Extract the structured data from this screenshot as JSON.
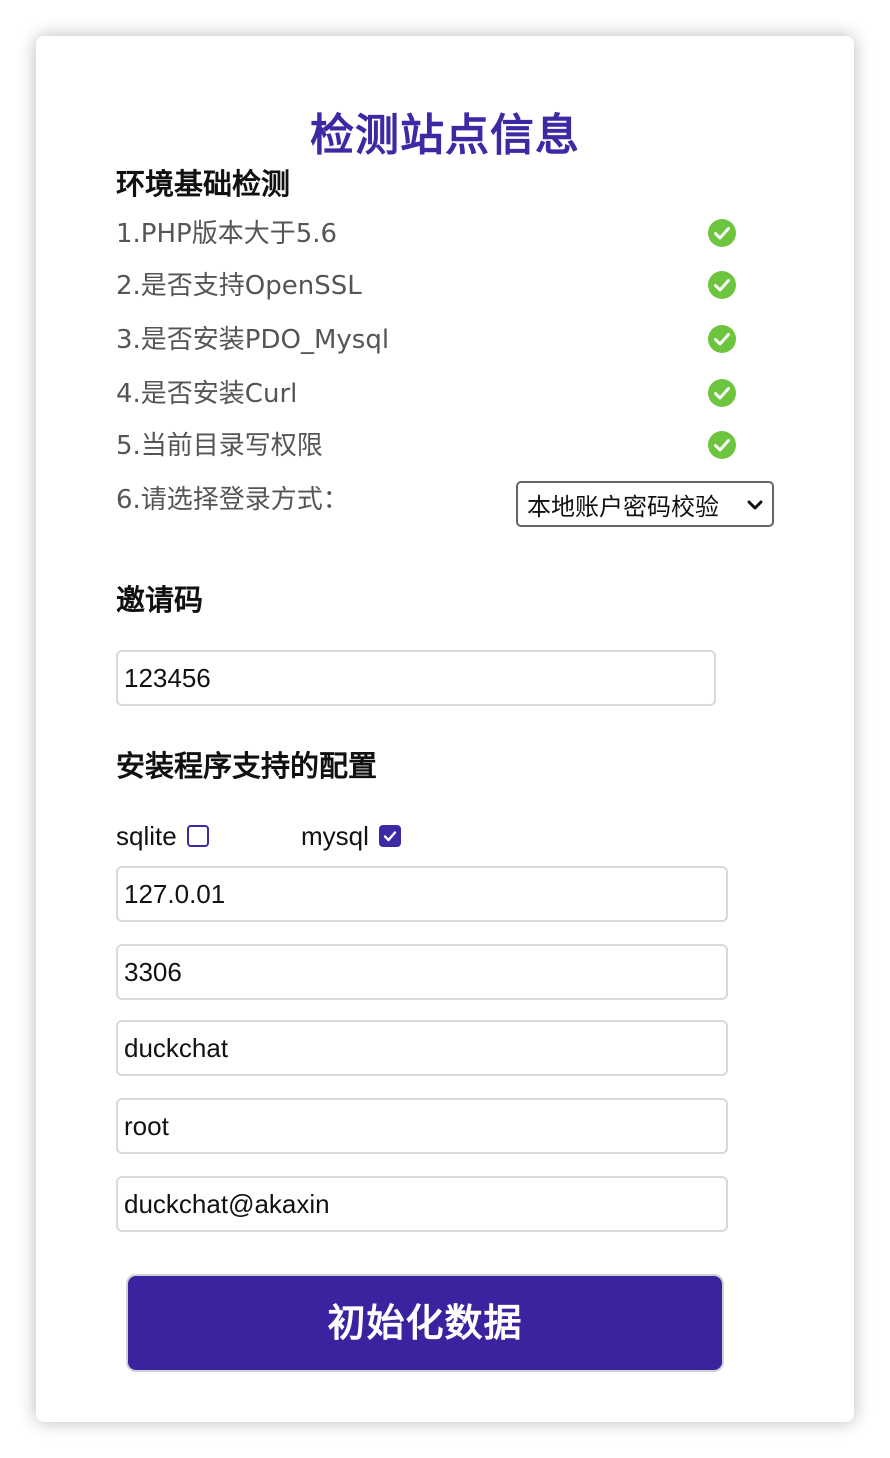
{
  "page": {
    "title": "检测站点信息"
  },
  "env_check": {
    "heading": "环境基础检测",
    "items": [
      {
        "label": "1.PHP版本大于5.6",
        "status": "ok"
      },
      {
        "label": "2.是否支持OpenSSL",
        "status": "ok"
      },
      {
        "label": "3.是否安装PDO_Mysql",
        "status": "ok"
      },
      {
        "label": "4.是否安装Curl",
        "status": "ok"
      },
      {
        "label": "5.当前目录写权限",
        "status": "ok"
      }
    ],
    "login_method": {
      "label": "6.请选择登录方式：",
      "selected": "本地账户密码校验"
    }
  },
  "invite": {
    "heading": "邀请码",
    "value": "123456"
  },
  "db_config": {
    "heading": "安装程序支持的配置",
    "options": [
      {
        "label": "sqlite",
        "checked": false
      },
      {
        "label": "mysql",
        "checked": true
      }
    ],
    "host": "127.0.01",
    "port": "3306",
    "database": "duckchat",
    "user": "root",
    "password": "duckchat@akaxin"
  },
  "submit": {
    "label": "初始化数据"
  },
  "colors": {
    "accent": "#3b2aa3",
    "button": "#3b239f",
    "ok_green": "#6cc53d"
  },
  "icons": {
    "status_ok": "check-circle-icon",
    "select": "chevron-down-icon",
    "checkbox_checked": "checkmark-icon"
  }
}
